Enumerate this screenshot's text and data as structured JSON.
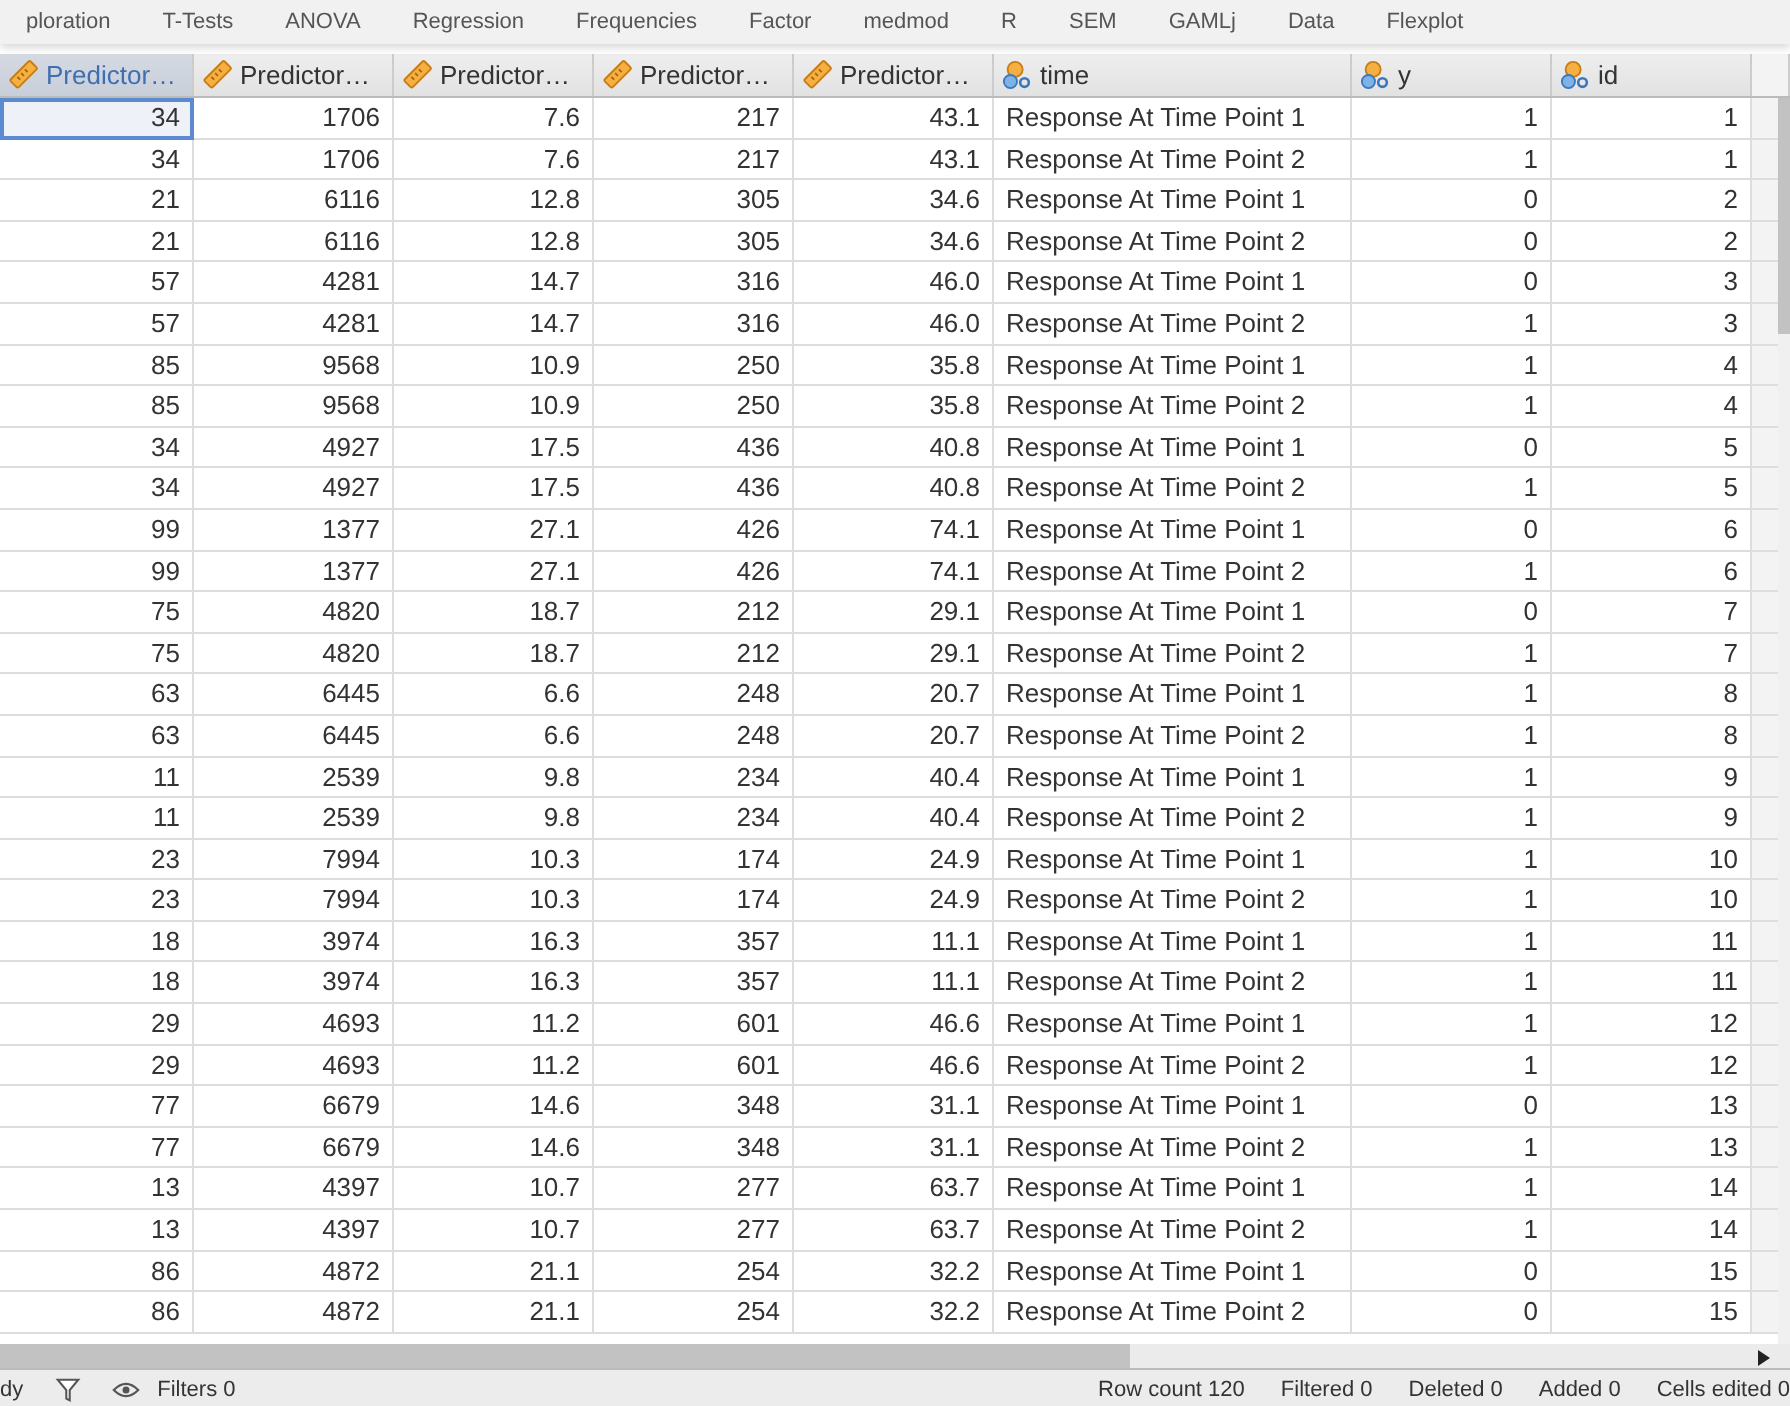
{
  "toolbar": [
    "ploration",
    "T-Tests",
    "ANOVA",
    "Regression",
    "Frequencies",
    "Factor",
    "medmod",
    "R",
    "SEM",
    "GAMLj",
    "Data",
    "Flexplot"
  ],
  "columns": [
    {
      "label": "Predictor…",
      "kind": "scale",
      "selected": true
    },
    {
      "label": "Predictor…",
      "kind": "scale",
      "selected": false
    },
    {
      "label": "Predictor…",
      "kind": "scale",
      "selected": false
    },
    {
      "label": "Predictor…",
      "kind": "scale",
      "selected": false
    },
    {
      "label": "Predictor…",
      "kind": "scale",
      "selected": false
    },
    {
      "label": "time",
      "kind": "nominal",
      "selected": false
    },
    {
      "label": "y",
      "kind": "nominal",
      "selected": false
    },
    {
      "label": "id",
      "kind": "nominal",
      "selected": false
    }
  ],
  "rows": [
    {
      "cells": [
        "34",
        "1706",
        "7.6",
        "217",
        "43.1",
        "Response At Time Point 1",
        "1",
        "1"
      ],
      "selected": true
    },
    {
      "cells": [
        "34",
        "1706",
        "7.6",
        "217",
        "43.1",
        "Response At Time Point 2",
        "1",
        "1"
      ],
      "selected": false
    },
    {
      "cells": [
        "21",
        "6116",
        "12.8",
        "305",
        "34.6",
        "Response At Time Point 1",
        "0",
        "2"
      ],
      "selected": false
    },
    {
      "cells": [
        "21",
        "6116",
        "12.8",
        "305",
        "34.6",
        "Response At Time Point 2",
        "0",
        "2"
      ],
      "selected": false
    },
    {
      "cells": [
        "57",
        "4281",
        "14.7",
        "316",
        "46.0",
        "Response At Time Point 1",
        "0",
        "3"
      ],
      "selected": false
    },
    {
      "cells": [
        "57",
        "4281",
        "14.7",
        "316",
        "46.0",
        "Response At Time Point 2",
        "1",
        "3"
      ],
      "selected": false
    },
    {
      "cells": [
        "85",
        "9568",
        "10.9",
        "250",
        "35.8",
        "Response At Time Point 1",
        "1",
        "4"
      ],
      "selected": false
    },
    {
      "cells": [
        "85",
        "9568",
        "10.9",
        "250",
        "35.8",
        "Response At Time Point 2",
        "1",
        "4"
      ],
      "selected": false
    },
    {
      "cells": [
        "34",
        "4927",
        "17.5",
        "436",
        "40.8",
        "Response At Time Point 1",
        "0",
        "5"
      ],
      "selected": false
    },
    {
      "cells": [
        "34",
        "4927",
        "17.5",
        "436",
        "40.8",
        "Response At Time Point 2",
        "1",
        "5"
      ],
      "selected": false
    },
    {
      "cells": [
        "99",
        "1377",
        "27.1",
        "426",
        "74.1",
        "Response At Time Point 1",
        "0",
        "6"
      ],
      "selected": false
    },
    {
      "cells": [
        "99",
        "1377",
        "27.1",
        "426",
        "74.1",
        "Response At Time Point 2",
        "1",
        "6"
      ],
      "selected": false
    },
    {
      "cells": [
        "75",
        "4820",
        "18.7",
        "212",
        "29.1",
        "Response At Time Point 1",
        "0",
        "7"
      ],
      "selected": false
    },
    {
      "cells": [
        "75",
        "4820",
        "18.7",
        "212",
        "29.1",
        "Response At Time Point 2",
        "1",
        "7"
      ],
      "selected": false
    },
    {
      "cells": [
        "63",
        "6445",
        "6.6",
        "248",
        "20.7",
        "Response At Time Point 1",
        "1",
        "8"
      ],
      "selected": false
    },
    {
      "cells": [
        "63",
        "6445",
        "6.6",
        "248",
        "20.7",
        "Response At Time Point 2",
        "1",
        "8"
      ],
      "selected": false
    },
    {
      "cells": [
        "11",
        "2539",
        "9.8",
        "234",
        "40.4",
        "Response At Time Point 1",
        "1",
        "9"
      ],
      "selected": false
    },
    {
      "cells": [
        "11",
        "2539",
        "9.8",
        "234",
        "40.4",
        "Response At Time Point 2",
        "1",
        "9"
      ],
      "selected": false
    },
    {
      "cells": [
        "23",
        "7994",
        "10.3",
        "174",
        "24.9",
        "Response At Time Point 1",
        "1",
        "10"
      ],
      "selected": false
    },
    {
      "cells": [
        "23",
        "7994",
        "10.3",
        "174",
        "24.9",
        "Response At Time Point 2",
        "1",
        "10"
      ],
      "selected": false
    },
    {
      "cells": [
        "18",
        "3974",
        "16.3",
        "357",
        "11.1",
        "Response At Time Point 1",
        "1",
        "11"
      ],
      "selected": false
    },
    {
      "cells": [
        "18",
        "3974",
        "16.3",
        "357",
        "11.1",
        "Response At Time Point 2",
        "1",
        "11"
      ],
      "selected": false
    },
    {
      "cells": [
        "29",
        "4693",
        "11.2",
        "601",
        "46.6",
        "Response At Time Point 1",
        "1",
        "12"
      ],
      "selected": false
    },
    {
      "cells": [
        "29",
        "4693",
        "11.2",
        "601",
        "46.6",
        "Response At Time Point 2",
        "1",
        "12"
      ],
      "selected": false
    },
    {
      "cells": [
        "77",
        "6679",
        "14.6",
        "348",
        "31.1",
        "Response At Time Point 1",
        "0",
        "13"
      ],
      "selected": false
    },
    {
      "cells": [
        "77",
        "6679",
        "14.6",
        "348",
        "31.1",
        "Response At Time Point 2",
        "1",
        "13"
      ],
      "selected": false
    },
    {
      "cells": [
        "13",
        "4397",
        "10.7",
        "277",
        "63.7",
        "Response At Time Point 1",
        "1",
        "14"
      ],
      "selected": false
    },
    {
      "cells": [
        "13",
        "4397",
        "10.7",
        "277",
        "63.7",
        "Response At Time Point 2",
        "1",
        "14"
      ],
      "selected": false
    },
    {
      "cells": [
        "86",
        "4872",
        "21.1",
        "254",
        "32.2",
        "Response At Time Point 1",
        "0",
        "15"
      ],
      "selected": false
    },
    {
      "cells": [
        "86",
        "4872",
        "21.1",
        "254",
        "32.2",
        "Response At Time Point 2",
        "0",
        "15"
      ],
      "selected": false
    }
  ],
  "status_bar": {
    "state": "dy",
    "filters": "Filters 0",
    "row_count": "Row count 120",
    "filtered": "Filtered 0",
    "deleted": "Deleted 0",
    "added": "Added 0",
    "edited": "Cells edited 0"
  }
}
